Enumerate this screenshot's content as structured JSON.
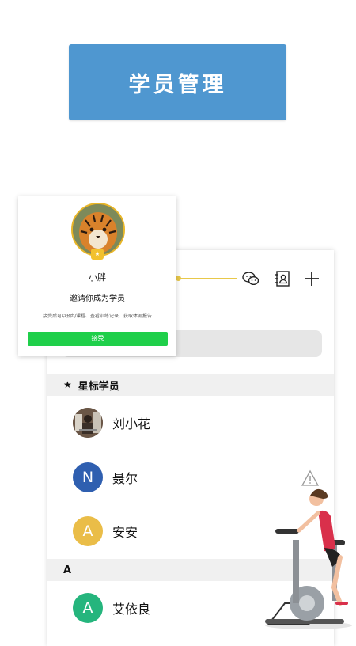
{
  "banner": {
    "title": "学员管理"
  },
  "invite_card": {
    "nickname": "小胖",
    "title": "邀请你成为学员",
    "description": "接受后可以预约课程、查看训练记录、获取体测报告",
    "accept_label": "接受",
    "badge": "★"
  },
  "toolbar": {
    "icons": [
      "wechat-icon",
      "contacts-icon",
      "add-icon"
    ]
  },
  "sections": [
    {
      "header": "星标学员",
      "icon": "star-icon",
      "contacts": [
        {
          "name": "刘小花",
          "avatar": "photo",
          "color": "#5a4a3c"
        },
        {
          "name": "聂尔",
          "avatar": "N",
          "color": "#2f5fb0"
        },
        {
          "name": "安安",
          "avatar": "A",
          "color": "#eabd48"
        }
      ]
    },
    {
      "header": "A",
      "contacts": [
        {
          "name": "艾依良",
          "avatar": "A",
          "color": "#25b57d"
        }
      ]
    }
  ],
  "colors": {
    "banner": "#4f97d0",
    "accept": "#1fcf4a",
    "accent_line": "#e8c84a"
  }
}
